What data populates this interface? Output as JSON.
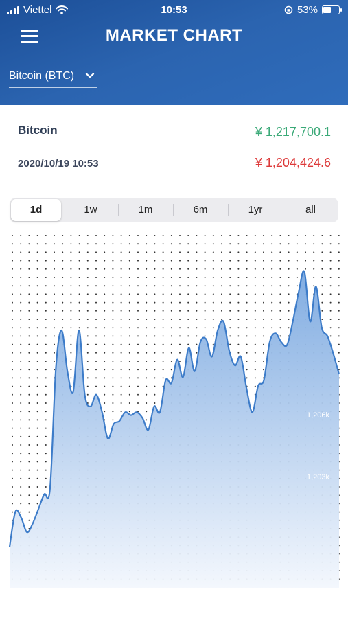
{
  "status_bar": {
    "carrier": "Viettel",
    "time": "10:53",
    "battery_percent": "53%",
    "battery_level": 0.53
  },
  "header": {
    "title": "MARKET CHART",
    "coin_selector": "Bitcoin (BTC)"
  },
  "info": {
    "name": "Bitcoin",
    "datetime": "2020/10/19 10:53",
    "price_high": "¥ 1,217,700.1",
    "price_low": "¥ 1,204,424.6",
    "colors": {
      "high": "#3aa977",
      "low": "#dd3a3a"
    }
  },
  "range_tabs": [
    "1d",
    "1w",
    "1m",
    "6m",
    "1yr",
    "all"
  ],
  "selected_range": "1d",
  "chart_data": {
    "type": "area",
    "tick_labels": [
      "1,206k",
      "1,203k"
    ],
    "values": [
      1200.4,
      1201.6,
      1201.4,
      1200.9,
      1201.2,
      1201.7,
      1202.2,
      1202.4,
      1206.5,
      1207.8,
      1206.4,
      1205.7,
      1207.8,
      1205.6,
      1205.2,
      1205.6,
      1205.0,
      1204.1,
      1204.6,
      1204.7,
      1205.0,
      1204.9,
      1205.0,
      1204.8,
      1204.4,
      1205.2,
      1205.0,
      1206.1,
      1206.0,
      1206.8,
      1206.2,
      1207.2,
      1206.4,
      1207.4,
      1207.5,
      1206.9,
      1207.8,
      1208.1,
      1207.1,
      1206.6,
      1206.9,
      1205.8,
      1205.0,
      1205.9,
      1206.1,
      1207.4,
      1207.7,
      1207.4,
      1207.3,
      1208.1,
      1209.1,
      1209.8,
      1208.1,
      1209.3,
      1207.9,
      1207.6,
      1207.0,
      1206.3
    ],
    "colors": {
      "line": "#3d7cc9",
      "fill_top": "#7aa8e0",
      "fill_bottom": "#f3f7fd"
    }
  }
}
